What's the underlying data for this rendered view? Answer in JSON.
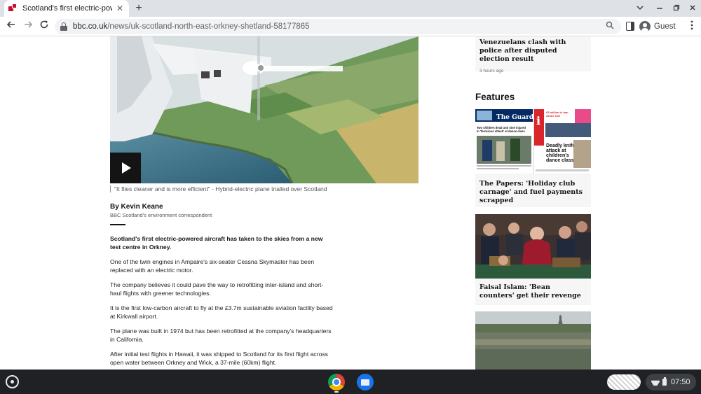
{
  "browser": {
    "tab_title": "Scotland's first electric-powered",
    "tab_close": "✕",
    "new_tab": "+",
    "url_domain": "bbc.co.uk",
    "url_path": "/news/uk-scotland-north-east-orkney-shetland-58177865",
    "profile_label": "Guest"
  },
  "article": {
    "caption": "\"It flies cleaner and is more efficient\" - Hybrid-electric plane trialled over Scotland",
    "author_name": "By Kevin Keane",
    "author_role": "BBC Scotland's environment correspondent",
    "paragraphs": [
      "Scotland's first electric-powered aircraft has taken to the skies from a new test centre in Orkney.",
      "One of the twin engines in Ampaire's six-seater Cessna Skymaster has been replaced with an electric motor.",
      "The company believes it could pave the way to retrofitting inter-island and short-haul flights with greener technologies.",
      "It is the first low-carbon aircraft to fly at the £3.7m sustainable aviation facility based at Kirkwall airport.",
      "The plane was built in 1974 but has been retrofitted at the company's headquarters in California.",
      "After initial test flights in Hawaii, it was shipped to Scotland for its first flight across open water between Orkney and Wick, a 37-mile (60km) flight."
    ]
  },
  "sidebar": {
    "top_story": {
      "headline": "Venezuelans clash with police after disputed election result",
      "time": "3 hours ago"
    },
    "features_title": "Features",
    "features": [
      {
        "headline": "The Papers: 'Holiday club carnage' and fuel payments scrapped"
      },
      {
        "headline": "Faisal Islam: 'Bean counters' get their revenge"
      }
    ],
    "newspaper_text": {
      "masthead": "The Guardian",
      "i_paper": "i",
      "guardian_headline": "Two children dead and nine injured in 'ferocious attack' at dance class",
      "i_headline": "Deadly knife attack at children's dance class"
    }
  },
  "shelf": {
    "clock": "07:50"
  }
}
